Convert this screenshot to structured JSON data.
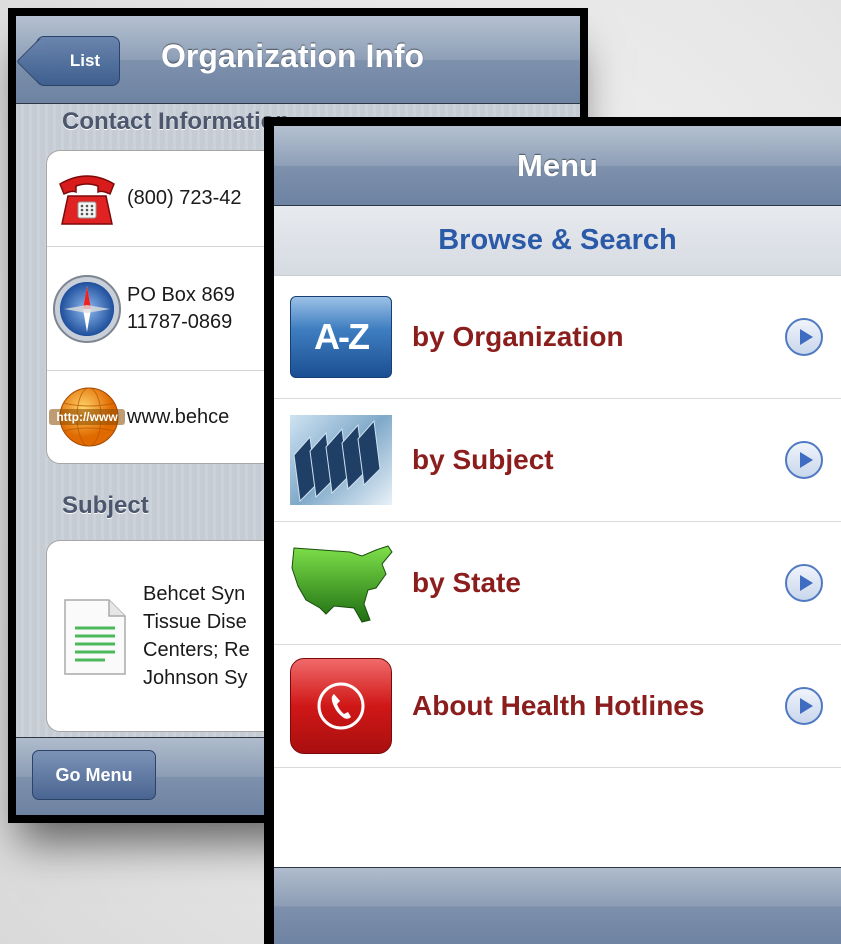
{
  "back_screen": {
    "nav": {
      "back_label": "List",
      "title": "Organization Info"
    },
    "contact_section": {
      "header": "Contact Information"
    },
    "contact_rows": [
      {
        "icon": "telephone-icon",
        "lines": [
          "(800) 723-42"
        ]
      },
      {
        "icon": "compass-icon",
        "lines": [
          "PO Box 869",
          "11787-0869"
        ]
      },
      {
        "icon": "globe-icon",
        "icon_text": "http://www",
        "lines": [
          "www.behce"
        ]
      }
    ],
    "subject_section": {
      "header": "Subject"
    },
    "subject_row": {
      "icon": "document-icon",
      "lines": [
        "Behcet Syn",
        "Tissue Dise",
        "Centers; Re",
        "Johnson Sy"
      ]
    },
    "toolbar": {
      "go_menu_label": "Go Menu"
    }
  },
  "front_screen": {
    "nav": {
      "title": "Menu"
    },
    "section_title": "Browse & Search",
    "menu_items": [
      {
        "label": "by Organization",
        "icon": "a-z-icon",
        "icon_text": "A-Z"
      },
      {
        "label": "by Subject",
        "icon": "files-icon"
      },
      {
        "label": "by State",
        "icon": "us-map-icon"
      },
      {
        "label": "About Health Hotlines",
        "icon": "phone-app-icon"
      }
    ]
  },
  "colors": {
    "menu_label": "#8b1d1d",
    "section_title": "#2b5aa8",
    "nav_bar": "#7e91ad"
  }
}
